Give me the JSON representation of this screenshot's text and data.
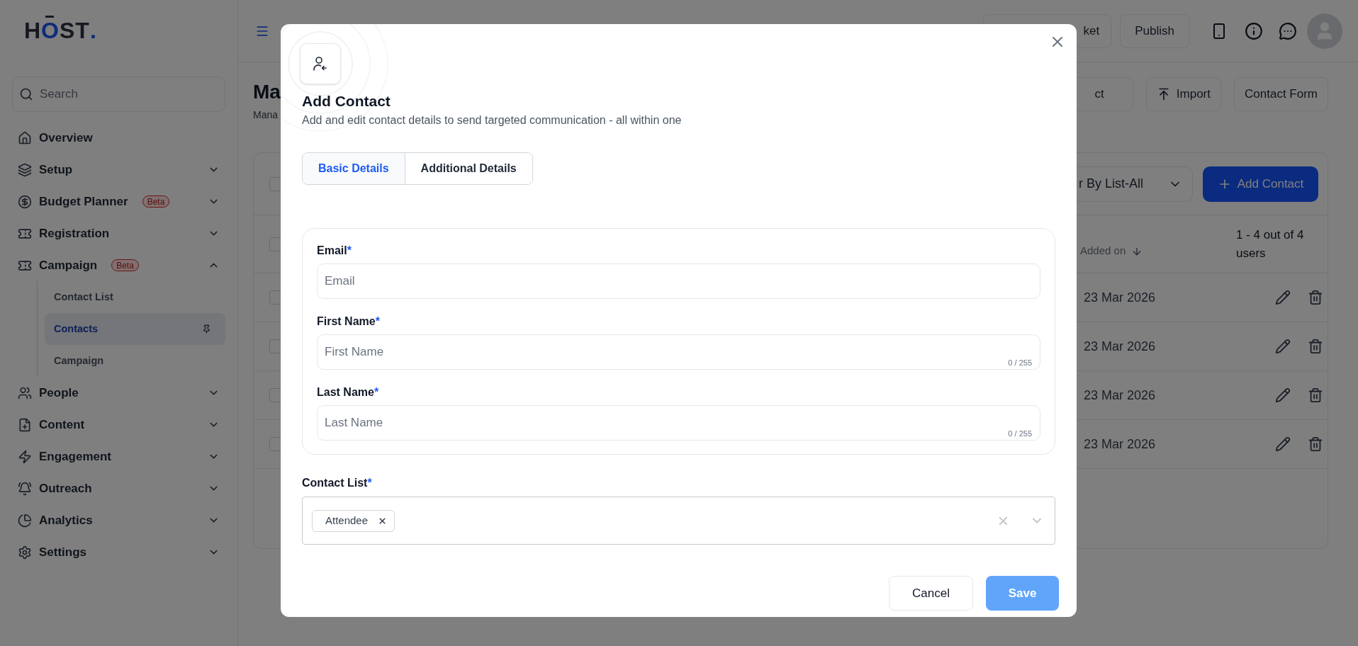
{
  "sidebar": {
    "logo": [
      {
        "text": "H",
        "accent": false
      },
      {
        "text": "O",
        "accent": true
      },
      {
        "text": "ST",
        "accent": false
      },
      {
        "text": ".",
        "accent": true
      }
    ],
    "search": {
      "placeholder": "Search"
    },
    "items": [
      {
        "label": "Overview"
      },
      {
        "label": "Setup",
        "expanded": false
      },
      {
        "label": "Budget Planner",
        "badge": "Beta",
        "expanded": false
      },
      {
        "label": "Registration",
        "expanded": false
      },
      {
        "label": "Campaign",
        "badge": "Beta",
        "expanded": true,
        "children": [
          {
            "label": "Contact List",
            "selected": false,
            "pinned": false
          },
          {
            "label": "Contacts",
            "selected": true,
            "pinned": true
          },
          {
            "label": "Campaign",
            "selected": false,
            "pinned": false
          }
        ]
      },
      {
        "label": "People",
        "expanded": false
      },
      {
        "label": "Content",
        "expanded": false
      },
      {
        "label": "Engagement",
        "expanded": false
      },
      {
        "label": "Outreach",
        "expanded": false
      },
      {
        "label": "Analytics",
        "expanded": false
      },
      {
        "label": "Settings",
        "expanded": false
      }
    ]
  },
  "topbar": {
    "buttons": [
      "ket",
      "Publish"
    ]
  },
  "page": {
    "title": "Ma",
    "subtitle": "Mana",
    "actions": [
      {
        "label": "ct",
        "kind": "plain"
      },
      {
        "label": "Import",
        "kind": "import"
      },
      {
        "label": "Contact Form",
        "kind": "plain"
      }
    ]
  },
  "table": {
    "select_all_checked": false,
    "filter": "r By List-All",
    "add_button": "Add Contact",
    "header_checked": false,
    "column": {
      "label": "Added on",
      "sort_descending": true
    },
    "count": "1 - 4 out of 4 users",
    "rows": [
      {
        "checked": false,
        "added_on": "23 Mar 2026"
      },
      {
        "checked": false,
        "added_on": "23 Mar 2026"
      },
      {
        "checked": false,
        "added_on": "23 Mar 2026"
      },
      {
        "checked": false,
        "added_on": "23 Mar 2026"
      }
    ]
  },
  "modal": {
    "title": "Add Contact",
    "subtitle": "Add and edit contact details to send targeted communication - all within one",
    "tabs": [
      {
        "label": "Basic Details",
        "selected": true
      },
      {
        "label": "Additional Details",
        "selected": false
      }
    ],
    "fields": [
      {
        "label": "Email",
        "required_mark": "*",
        "placeholder": "Email"
      },
      {
        "label": "First Name",
        "required_mark": "*",
        "placeholder": "First Name",
        "counter": "0 / 255"
      },
      {
        "label": "Last Name",
        "required_mark": "*",
        "placeholder": "Last Name",
        "counter": "0 / 255"
      }
    ],
    "contact_list": {
      "label": "Contact List",
      "required_mark": "*",
      "chips": [
        "Attendee"
      ]
    },
    "buttons": [
      {
        "label": "Cancel",
        "kind": "secondary"
      },
      {
        "label": "Save",
        "kind": "primary"
      }
    ]
  }
}
